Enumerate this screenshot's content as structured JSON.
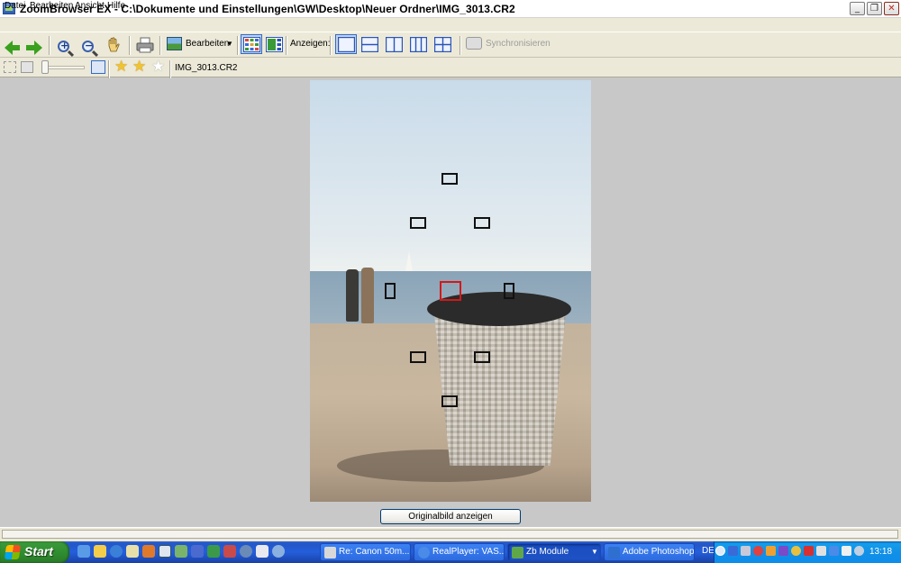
{
  "window": {
    "title": "ZoomBrowser EX - C:\\Dokumente und Einstellungen\\GW\\Desktop\\Neuer Ordner\\IMG_3013.CR2",
    "min_glyph": "_",
    "max_glyph": "❐",
    "close_glyph": "✕"
  },
  "menu": {
    "datei": "Datei",
    "bearbeiten": "Bearbeiten",
    "ansicht": "Ansicht",
    "hilfe": "Hilfe"
  },
  "toolbar": {
    "bearbeiten_label": "Bearbeiten",
    "bearbeiten_caret": "▼",
    "anzeigen_label": "Anzeigen:",
    "sync_label": "Synchronisieren"
  },
  "toolbar2": {
    "filename": "IMG_3013.CR2",
    "rating": 2,
    "stars_total": 3,
    "zoom_level": 0
  },
  "viewer": {
    "original_button": "Originalbild anzeigen"
  },
  "taskbar": {
    "start_label": "Start",
    "tasks": [
      {
        "label": "Re: Canon 50m...",
        "icon_color": "#d8d8d8"
      },
      {
        "label": "RealPlayer: VAS...",
        "icon_color": "#4a8ae8"
      },
      {
        "label": "Zb Module",
        "icon_color": "#5fa84a"
      },
      {
        "label": "Adobe Photoshop",
        "icon_color": "#2f6fd0"
      }
    ],
    "language": "DE",
    "clock": "13:18"
  },
  "colors": {
    "titlebar": "#ffffff",
    "chrome": "#ece9d8",
    "viewer_bg": "#c8c8c8",
    "active_af_point": "#d31818",
    "taskbar": "#245edb",
    "start_green": "#2f8f2f"
  }
}
